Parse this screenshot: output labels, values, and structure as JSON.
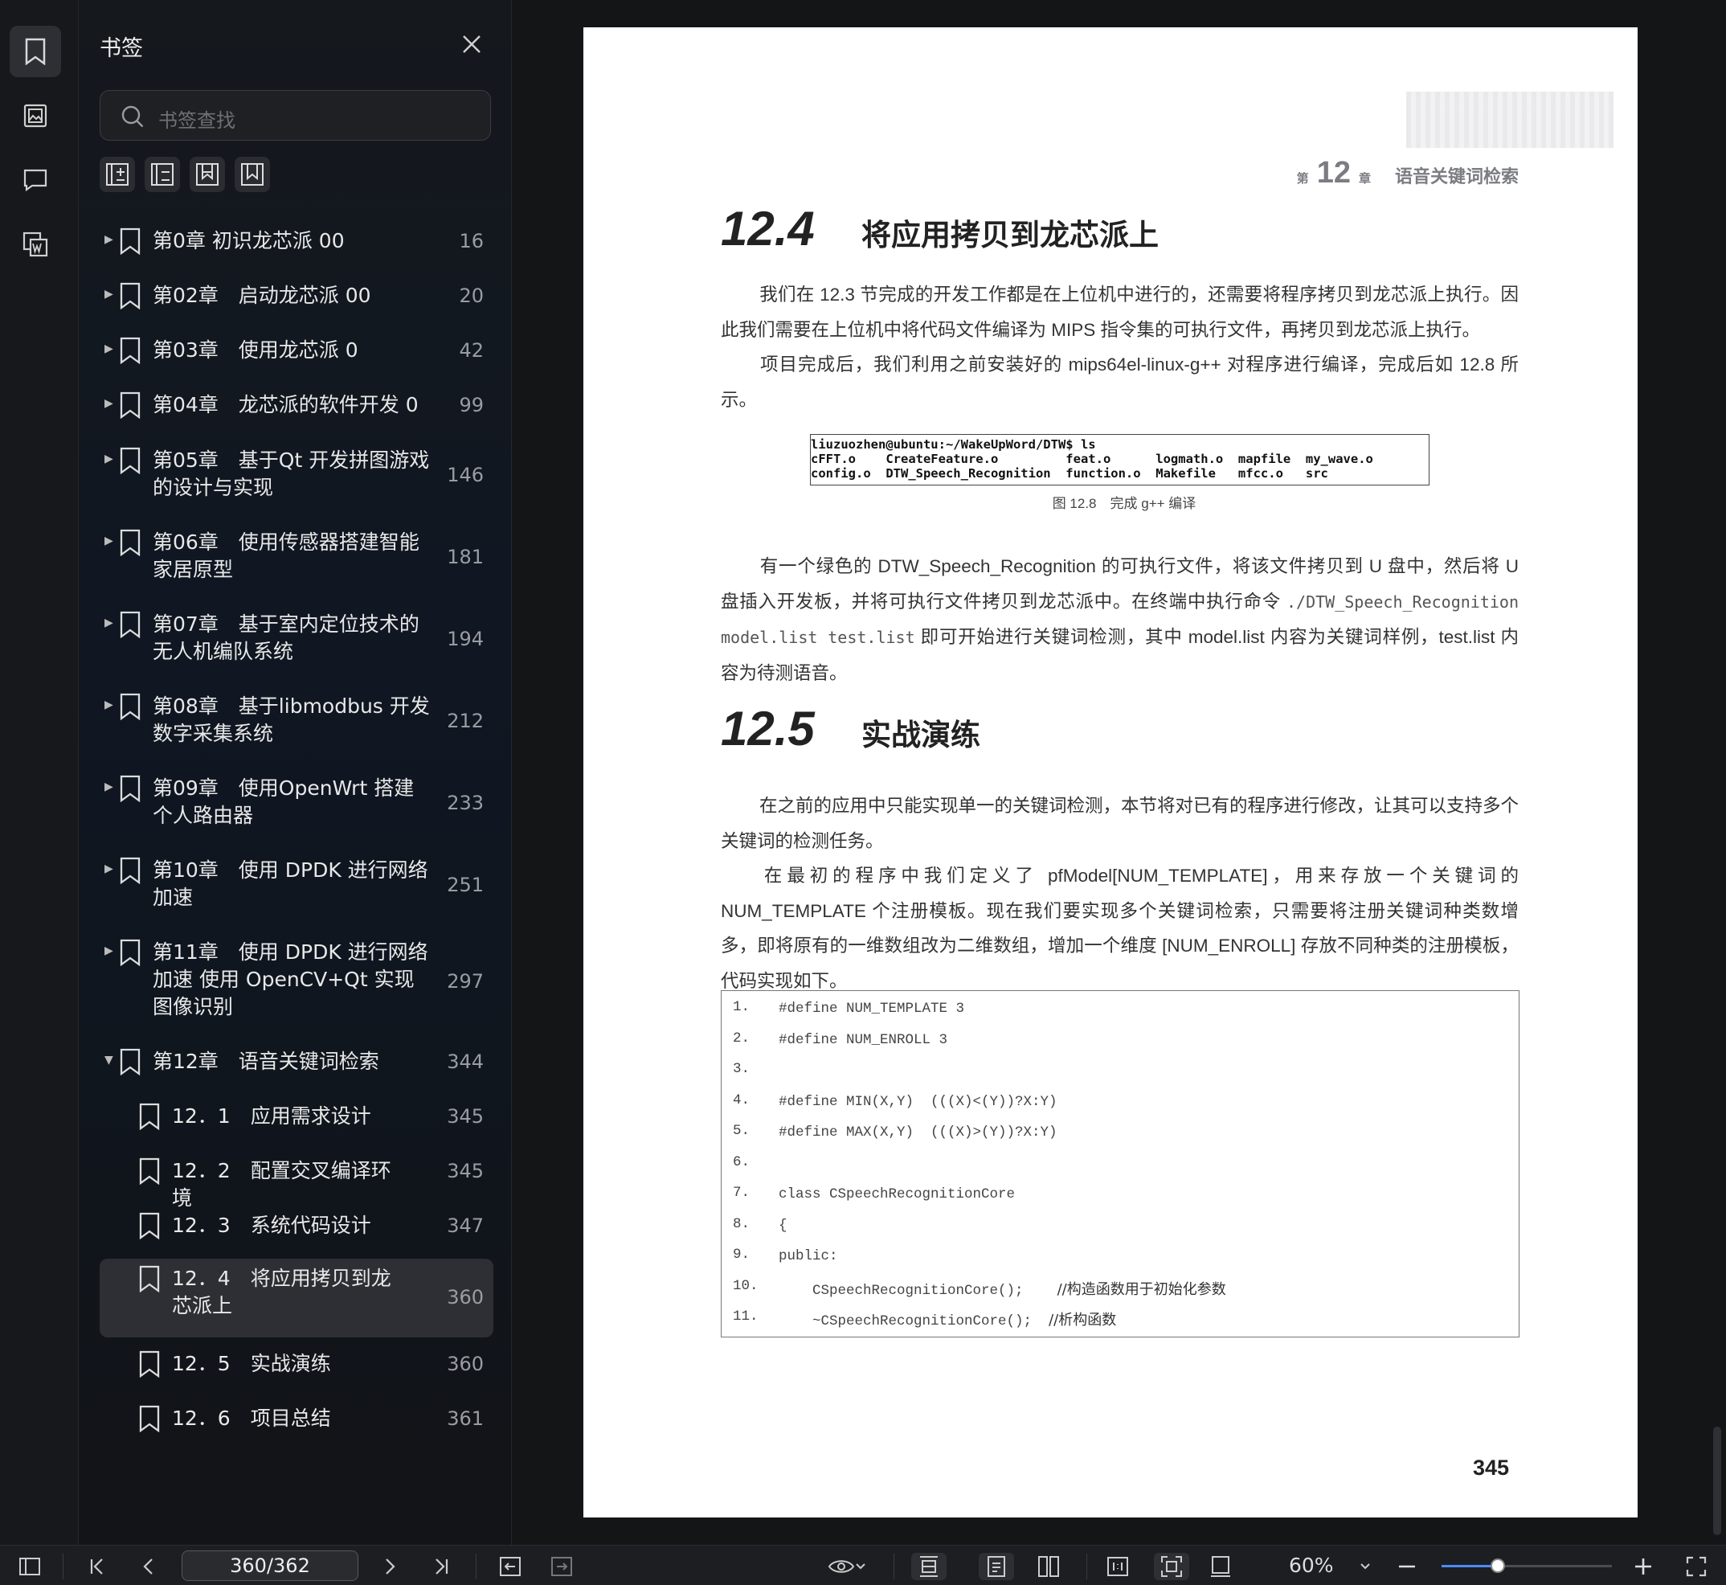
{
  "sidebar": {
    "title": "书签",
    "search_placeholder": "书签查找",
    "items": [
      {
        "label": "第0章 初识龙芯派 00",
        "page": "16",
        "expanded": false,
        "level": 1
      },
      {
        "label": "第02章　启动龙芯派 00",
        "page": "20",
        "expanded": false,
        "level": 1
      },
      {
        "label": "第03章　使用龙芯派 0",
        "page": "42",
        "expanded": false,
        "level": 1
      },
      {
        "label": "第04章　龙芯派的软件开发 0",
        "page": "99",
        "expanded": false,
        "level": 1
      },
      {
        "label": "第05章　基于Qt 开发拼图游戏的设计与实现",
        "page": "146",
        "expanded": false,
        "level": 1
      },
      {
        "label": "第06章　使用传感器搭建智能家居原型",
        "page": "181",
        "expanded": false,
        "level": 1
      },
      {
        "label": "第07章　基于室内定位技术的无人机编队系统",
        "page": "194",
        "expanded": false,
        "level": 1
      },
      {
        "label": "第08章　基于libmodbus 开发数字采集系统",
        "page": "212",
        "expanded": false,
        "level": 1
      },
      {
        "label": "第09章　使用OpenWrt 搭建个人路由器",
        "page": "233",
        "expanded": false,
        "level": 1
      },
      {
        "label": "第10章　使用 DPDK 进行网络加速",
        "page": "251",
        "expanded": false,
        "level": 1
      },
      {
        "label": "第11章　使用 DPDK 进行网络加速 使用 OpenCV+Qt 实现图像识别",
        "page": "297",
        "expanded": false,
        "level": 1
      },
      {
        "label": "第12章　语音关键词检索",
        "page": "344",
        "expanded": true,
        "level": 1
      },
      {
        "label": "12．1　应用需求设计",
        "page": "345",
        "level": 2
      },
      {
        "label": "12．2　配置交叉编译环境",
        "page": "345",
        "level": 2
      },
      {
        "label": "12．3　系统代码设计",
        "page": "347",
        "level": 2
      },
      {
        "label": "12．4　将应用拷贝到龙芯派上",
        "page": "360",
        "level": 2,
        "selected": true
      },
      {
        "label": "12．5　实战演练",
        "page": "360",
        "level": 2
      },
      {
        "label": "12．6　项目总结",
        "page": "361",
        "level": 2
      }
    ]
  },
  "page": {
    "header_prefix": "第",
    "header_chapter_num": "12",
    "header_suffix": "章",
    "header_title": "语音关键词检索",
    "sec1_num": "12.4",
    "sec1_title": "将应用拷贝到龙芯派上",
    "p1": "我们在 12.3 节完成的开发工作都是在上位机中进行的，还需要将程序拷贝到龙芯派上执行。因此我们需要在上位机中将代码文件编译为 MIPS 指令集的可执行文件，再拷贝到龙芯派上执行。",
    "p2": "项目完成后，我们利用之前安装好的 mips64el-linux-g++ 对程序进行编译，完成后如 12.8 所示。",
    "terminal": [
      "liuzuozhen@ubuntu:~/WakeUpWord/DTW$ ls",
      "cFFT.o    CreateFeature.o         feat.o      logmath.o  mapfile  my_wave.o",
      "config.o  DTW_Speech_Recognition  function.o  Makefile   mfcc.o   src"
    ],
    "fig_caption": "图 12.8　完成 g++ 编译",
    "p3a": "有一个绿色的 DTW_Speech_Recognition 的可执行文件，将该文件拷贝到 U 盘中，然后将 U 盘插入开发板，并将可执行文件拷贝到龙芯派中。在终端中执行命令 ",
    "p3cmd": "./DTW_Speech_Recognition model.list test.list",
    "p3b": " 即可开始进行关键词检测，其中 model.list 内容为关键词样例，test.list 内容为待测语音。",
    "sec2_num": "12.5",
    "sec2_title": "实战演练",
    "p4": "在之前的应用中只能实现单一的关键词检测，本节将对已有的程序进行修改，让其可以支持多个关键词的检测任务。",
    "p5": "在最初的程序中我们定义了 pfModel[NUM_TEMPLATE]，用来存放一个关键词的 NUM_TEMPLATE 个注册模板。现在我们要实现多个关键词检索，只需要将注册关键词种类数增多，即将原有的一维数组改为二维数组，增加一个维度 [NUM_ENROLL] 存放不同种类的注册模板，代码实现如下。",
    "code": [
      {
        "n": "1.",
        "code": "#define NUM_TEMPLATE 3",
        "comment": ""
      },
      {
        "n": "2.",
        "code": "#define NUM_ENROLL 3",
        "comment": ""
      },
      {
        "n": "3.",
        "code": "",
        "comment": ""
      },
      {
        "n": "4.",
        "code": "#define MIN(X,Y)  (((X)<(Y))?X:Y)",
        "comment": ""
      },
      {
        "n": "5.",
        "code": "#define MAX(X,Y)  (((X)>(Y))?X:Y)",
        "comment": ""
      },
      {
        "n": "6.",
        "code": "",
        "comment": ""
      },
      {
        "n": "7.",
        "code": "class CSpeechRecognitionCore",
        "comment": ""
      },
      {
        "n": "8.",
        "code": "{",
        "comment": ""
      },
      {
        "n": "9.",
        "code": "public:",
        "comment": ""
      },
      {
        "n": "10.",
        "code": "    CSpeechRecognitionCore();    ",
        "comment": "//构造函数用于初始化参数"
      },
      {
        "n": "11.",
        "code": "    ~CSpeechRecognitionCore();  ",
        "comment": "//析构函数"
      }
    ],
    "page_number": "345"
  },
  "toolbar": {
    "page_indicator": "360/362",
    "zoom": "60%",
    "zoom_fraction": 0.33
  }
}
